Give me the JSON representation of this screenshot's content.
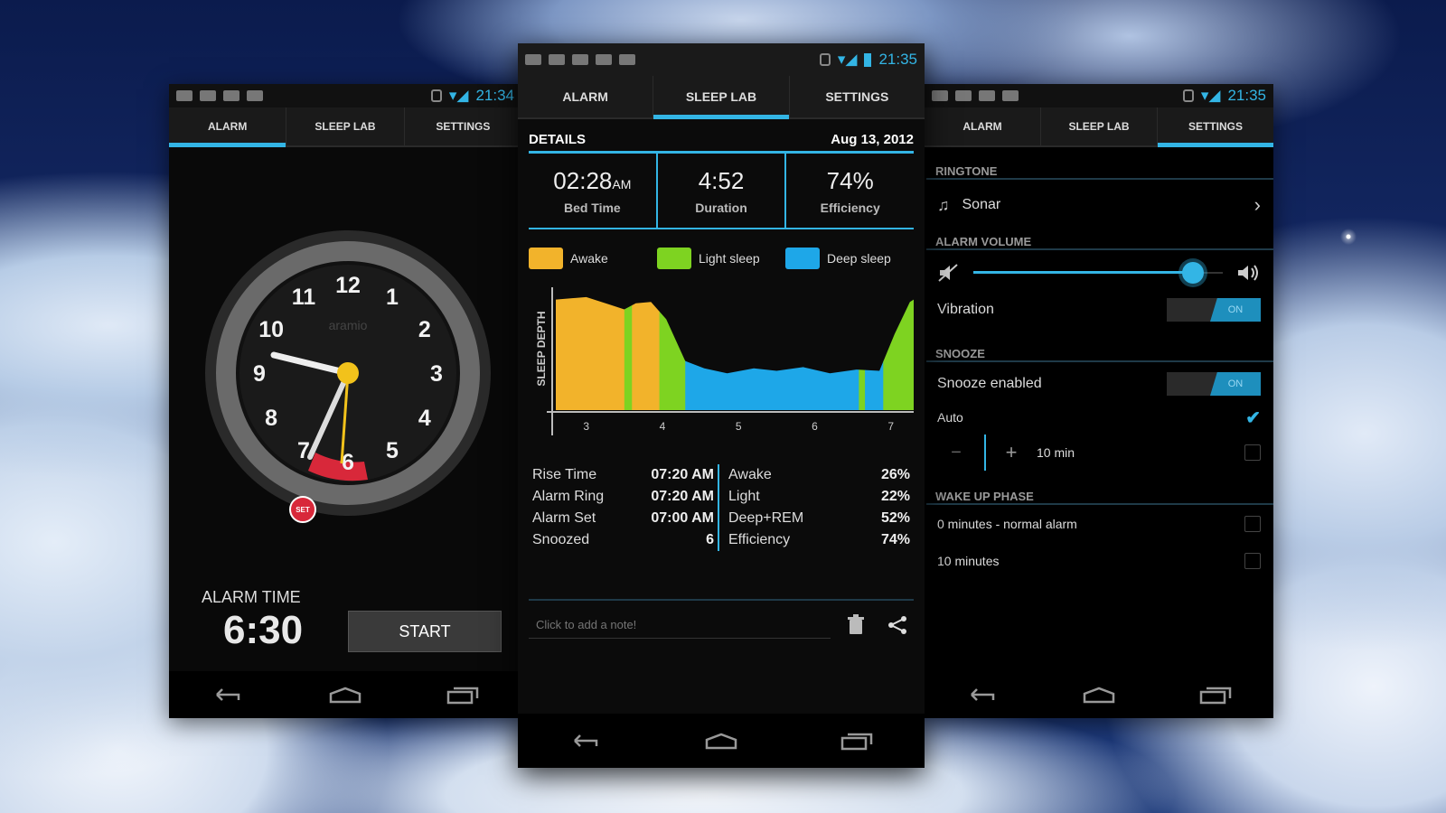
{
  "theme": {
    "accent": "#33b5e5",
    "awake": "#f2b32b",
    "light_sleep": "#7ed321",
    "deep_sleep": "#1ea7e8"
  },
  "tabs": [
    "ALARM",
    "SLEEP LAB",
    "SETTINGS"
  ],
  "left": {
    "status_time": "21:34",
    "active_tab": "ALARM",
    "clock": {
      "numbers": [
        "12",
        "1",
        "2",
        "3",
        "4",
        "5",
        "6",
        "7",
        "8",
        "9",
        "10",
        "11"
      ],
      "brand": "aramio",
      "set_label": "SET"
    },
    "alarm_time_label": "ALARM TIME",
    "alarm_time": "6:30",
    "start_label": "START"
  },
  "middle": {
    "status_time": "21:35",
    "active_tab": "SLEEP LAB",
    "details_label": "DETAILS",
    "date": "Aug 13, 2012",
    "bed_time": {
      "value": "02:28",
      "suffix": "AM",
      "label": "Bed Time"
    },
    "duration": {
      "value": "4:52",
      "label": "Duration"
    },
    "efficiency": {
      "value": "74%",
      "label": "Efficiency"
    },
    "legend": [
      "Awake",
      "Light sleep",
      "Deep sleep"
    ],
    "summary_left": [
      {
        "label": "Rise Time",
        "value": "07:20 AM"
      },
      {
        "label": "Alarm Ring",
        "value": "07:20 AM"
      },
      {
        "label": "Alarm Set",
        "value": "07:00 AM"
      },
      {
        "label": "Snoozed",
        "value": "6"
      }
    ],
    "summary_right": [
      {
        "label": "Awake",
        "value": "26%"
      },
      {
        "label": "Light",
        "value": "22%"
      },
      {
        "label": "Deep+REM",
        "value": "52%"
      },
      {
        "label": "Efficiency",
        "value": "74%"
      }
    ],
    "note_placeholder": "Click to add a note!"
  },
  "chart_data": {
    "type": "area",
    "ylabel": "SLEEP DEPTH",
    "x_ticks": [
      "3",
      "4",
      "5",
      "6",
      "7"
    ],
    "xlim": [
      2.6,
      7.3
    ],
    "segments": [
      {
        "stage": "Awake",
        "from": 2.6,
        "to": 3.5
      },
      {
        "stage": "Light sleep",
        "from": 3.5,
        "to": 3.6
      },
      {
        "stage": "Awake",
        "from": 3.6,
        "to": 3.96
      },
      {
        "stage": "Light sleep",
        "from": 3.96,
        "to": 4.3
      },
      {
        "stage": "Deep sleep",
        "from": 4.3,
        "to": 6.58
      },
      {
        "stage": "Light sleep",
        "from": 6.58,
        "to": 6.66
      },
      {
        "stage": "Deep sleep",
        "from": 6.66,
        "to": 6.9
      },
      {
        "stage": "Light sleep",
        "from": 6.9,
        "to": 7.3
      }
    ],
    "depth_curve": [
      [
        2.6,
        0.9
      ],
      [
        3.0,
        0.92
      ],
      [
        3.3,
        0.86
      ],
      [
        3.5,
        0.82
      ],
      [
        3.65,
        0.87
      ],
      [
        3.85,
        0.88
      ],
      [
        4.05,
        0.74
      ],
      [
        4.3,
        0.4
      ],
      [
        4.55,
        0.34
      ],
      [
        4.85,
        0.3
      ],
      [
        5.2,
        0.34
      ],
      [
        5.5,
        0.32
      ],
      [
        5.85,
        0.35
      ],
      [
        6.2,
        0.3
      ],
      [
        6.55,
        0.33
      ],
      [
        6.85,
        0.32
      ],
      [
        7.05,
        0.62
      ],
      [
        7.25,
        0.88
      ],
      [
        7.3,
        0.9
      ]
    ]
  },
  "right": {
    "status_time": "21:35",
    "active_tab": "SETTINGS",
    "ringtone_header": "RINGTONE",
    "ringtone": "Sonar",
    "volume_header": "ALARM VOLUME",
    "volume_level": 0.88,
    "vibration_label": "Vibration",
    "vibration_state": "ON",
    "snooze_header": "SNOOZE",
    "snooze_enabled_label": "Snooze enabled",
    "snooze_state": "ON",
    "auto_label": "Auto",
    "snooze_minus": "−",
    "snooze_plus": "+",
    "snooze_value": "10 min",
    "wake_header": "WAKE UP PHASE",
    "wake_options": [
      "0 minutes - normal alarm",
      "10 minutes"
    ]
  }
}
